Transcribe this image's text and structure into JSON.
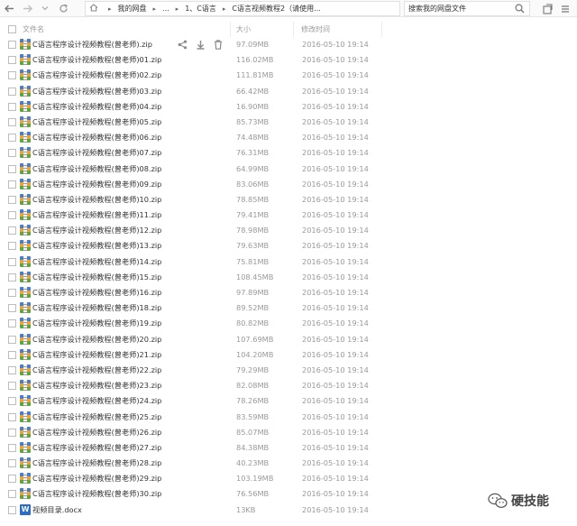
{
  "toolbar": {
    "breadcrumb": [
      "我的网盘",
      "...",
      "1、C语言",
      "C语言视频教程2（请使用..."
    ],
    "search_placeholder": "搜索我的网盘文件"
  },
  "header": {
    "name": "文件名",
    "size": "大小",
    "time": "修改时间"
  },
  "icons": {
    "zip": "zip-archive-icon",
    "docx": "word-doc-icon"
  },
  "files": [
    {
      "name": "C语言程序设计视频教程(曾老师).zip",
      "size": "97.09MB",
      "time": "2016-05-10 19:14",
      "type": "zip"
    },
    {
      "name": "C语言程序设计视频教程(曾老师)01.zip",
      "size": "116.02MB",
      "time": "2016-05-10 19:14",
      "type": "zip"
    },
    {
      "name": "C语言程序设计视频教程(曾老师)02.zip",
      "size": "111.81MB",
      "time": "2016-05-10 19:14",
      "type": "zip"
    },
    {
      "name": "C语言程序设计视频教程(曾老师)03.zip",
      "size": "66.42MB",
      "time": "2016-05-10 19:14",
      "type": "zip"
    },
    {
      "name": "C语言程序设计视频教程(曾老师)04.zip",
      "size": "16.90MB",
      "time": "2016-05-10 19:14",
      "type": "zip"
    },
    {
      "name": "C语言程序设计视频教程(曾老师)05.zip",
      "size": "85.73MB",
      "time": "2016-05-10 19:14",
      "type": "zip"
    },
    {
      "name": "C语言程序设计视频教程(曾老师)06.zip",
      "size": "74.48MB",
      "time": "2016-05-10 19:14",
      "type": "zip"
    },
    {
      "name": "C语言程序设计视频教程(曾老师)07.zip",
      "size": "76.31MB",
      "time": "2016-05-10 19:14",
      "type": "zip"
    },
    {
      "name": "C语言程序设计视频教程(曾老师)08.zip",
      "size": "64.99MB",
      "time": "2016-05-10 19:14",
      "type": "zip"
    },
    {
      "name": "C语言程序设计视频教程(曾老师)09.zip",
      "size": "83.06MB",
      "time": "2016-05-10 19:14",
      "type": "zip"
    },
    {
      "name": "C语言程序设计视频教程(曾老师)10.zip",
      "size": "78.85MB",
      "time": "2016-05-10 19:14",
      "type": "zip"
    },
    {
      "name": "C语言程序设计视频教程(曾老师)11.zip",
      "size": "79.41MB",
      "time": "2016-05-10 19:14",
      "type": "zip"
    },
    {
      "name": "C语言程序设计视频教程(曾老师)12.zip",
      "size": "78.98MB",
      "time": "2016-05-10 19:14",
      "type": "zip"
    },
    {
      "name": "C语言程序设计视频教程(曾老师)13.zip",
      "size": "79.63MB",
      "time": "2016-05-10 19:14",
      "type": "zip"
    },
    {
      "name": "C语言程序设计视频教程(曾老师)14.zip",
      "size": "75.81MB",
      "time": "2016-05-10 19:14",
      "type": "zip"
    },
    {
      "name": "C语言程序设计视频教程(曾老师)15.zip",
      "size": "108.45MB",
      "time": "2016-05-10 19:14",
      "type": "zip"
    },
    {
      "name": "C语言程序设计视频教程(曾老师)16.zip",
      "size": "97.89MB",
      "time": "2016-05-10 19:14",
      "type": "zip"
    },
    {
      "name": "C语言程序设计视频教程(曾老师)18.zip",
      "size": "89.52MB",
      "time": "2016-05-10 19:14",
      "type": "zip"
    },
    {
      "name": "C语言程序设计视频教程(曾老师)19.zip",
      "size": "80.82MB",
      "time": "2016-05-10 19:14",
      "type": "zip"
    },
    {
      "name": "C语言程序设计视频教程(曾老师)20.zip",
      "size": "107.69MB",
      "time": "2016-05-10 19:14",
      "type": "zip"
    },
    {
      "name": "C语言程序设计视频教程(曾老师)21.zip",
      "size": "104.20MB",
      "time": "2016-05-10 19:14",
      "type": "zip"
    },
    {
      "name": "C语言程序设计视频教程(曾老师)22.zip",
      "size": "79.29MB",
      "time": "2016-05-10 19:14",
      "type": "zip"
    },
    {
      "name": "C语言程序设计视频教程(曾老师)23.zip",
      "size": "82.08MB",
      "time": "2016-05-10 19:14",
      "type": "zip"
    },
    {
      "name": "C语言程序设计视频教程(曾老师)24.zip",
      "size": "78.26MB",
      "time": "2016-05-10 19:14",
      "type": "zip"
    },
    {
      "name": "C语言程序设计视频教程(曾老师)25.zip",
      "size": "83.59MB",
      "time": "2016-05-10 19:14",
      "type": "zip"
    },
    {
      "name": "C语言程序设计视频教程(曾老师)26.zip",
      "size": "85.07MB",
      "time": "2016-05-10 19:14",
      "type": "zip"
    },
    {
      "name": "C语言程序设计视频教程(曾老师)27.zip",
      "size": "84.38MB",
      "time": "2016-05-10 19:14",
      "type": "zip"
    },
    {
      "name": "C语言程序设计视频教程(曾老师)28.zip",
      "size": "40.23MB",
      "time": "2016-05-10 19:14",
      "type": "zip"
    },
    {
      "name": "C语言程序设计视频教程(曾老师)29.zip",
      "size": "103.19MB",
      "time": "2016-05-10 19:14",
      "type": "zip"
    },
    {
      "name": "C语言程序设计视频教程(曾老师)30.zip",
      "size": "76.56MB",
      "time": "2016-05-10 19:14",
      "type": "zip"
    },
    {
      "name": "视频目录.docx",
      "size": "13KB",
      "time": "2016-05-10 19:14",
      "type": "docx"
    }
  ],
  "docx_icon_letter": "W",
  "watermark": "硬技能"
}
